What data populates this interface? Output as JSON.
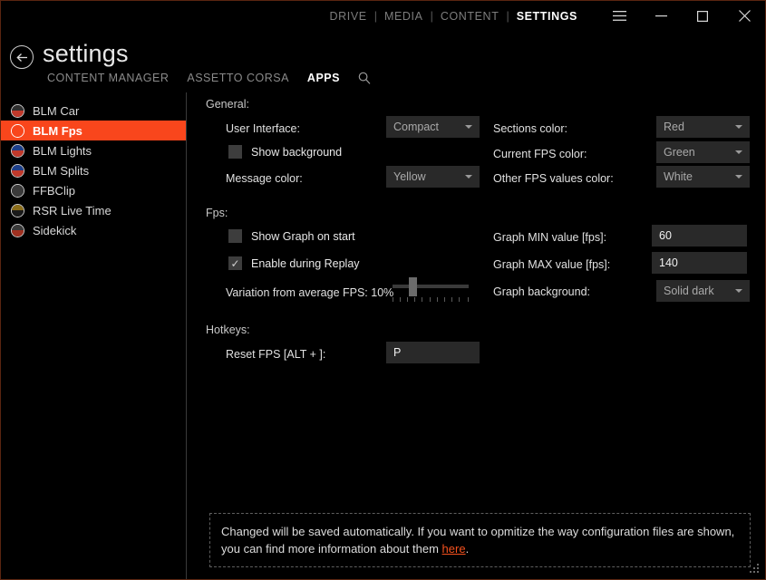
{
  "window": {
    "topnav": [
      {
        "label": "DRIVE",
        "active": false
      },
      {
        "label": "MEDIA",
        "active": false
      },
      {
        "label": "CONTENT",
        "active": false
      },
      {
        "label": "SETTINGS",
        "active": true
      }
    ],
    "separator": "|",
    "controls": {
      "menu": "hamburger-icon",
      "minimize": "minimize-icon",
      "maximize": "maximize-icon",
      "close": "close-icon"
    },
    "border_color": "#5a2510"
  },
  "header": {
    "back": "back-arrow-icon",
    "title": "settings",
    "tabs": [
      {
        "label": "CONTENT MANAGER",
        "active": false
      },
      {
        "label": "ASSETTO CORSA",
        "active": false
      },
      {
        "label": "APPS",
        "active": true
      }
    ],
    "search_icon": "search-icon"
  },
  "sidebar": {
    "selected_color": "#f9461c",
    "items": [
      {
        "label": "BLM Car",
        "selected": false,
        "icon_top": "#2f2f2f",
        "icon_bottom": "#c0392b"
      },
      {
        "label": "BLM Fps",
        "selected": true,
        "icon_top": "#f9461c",
        "icon_bottom": "#f9461c"
      },
      {
        "label": "BLM Lights",
        "selected": false,
        "icon_top": "#1d3f8a",
        "icon_bottom": "#c0392b"
      },
      {
        "label": "BLM Splits",
        "selected": false,
        "icon_top": "#1d3f8a",
        "icon_bottom": "#c0392b"
      },
      {
        "label": "FFBClip",
        "selected": false,
        "icon_top": "#3a3a3a",
        "icon_bottom": "#3a3a3a"
      },
      {
        "label": "RSR Live Time",
        "selected": false,
        "icon_top": "#8a6d1a",
        "icon_bottom": "#1a1a1a"
      },
      {
        "label": "Sidekick",
        "selected": false,
        "icon_top": "#3a3a3a",
        "icon_bottom": "#a03020"
      }
    ]
  },
  "main": {
    "groups": {
      "general": "General:",
      "fps": "Fps:",
      "hotkeys": "Hotkeys:"
    },
    "general": {
      "user_interface": {
        "label": "User Interface:",
        "value": "Compact"
      },
      "show_background": {
        "label": "Show background",
        "checked": false
      },
      "message_color": {
        "label": "Message color:",
        "value": "Yellow"
      },
      "sections_color": {
        "label": "Sections color:",
        "value": "Red"
      },
      "current_fps_color": {
        "label": "Current FPS color:",
        "value": "Green"
      },
      "other_fps_values_color": {
        "label": "Other FPS values color:",
        "value": "White"
      }
    },
    "fps": {
      "show_graph_on_start": {
        "label": "Show Graph on start",
        "checked": false
      },
      "enable_during_replay": {
        "label": "Enable during Replay",
        "checked": true,
        "check_glyph": "✓"
      },
      "variation": {
        "label": "Variation from average FPS: 10%",
        "value": 10,
        "min": 0,
        "max": 100,
        "ticks": 11
      },
      "graph_min": {
        "label": "Graph MIN value [fps]:",
        "value": "60"
      },
      "graph_max": {
        "label": "Graph MAX value [fps]:",
        "value": "140"
      },
      "graph_background": {
        "label": "Graph background:",
        "value": "Solid dark"
      }
    },
    "hotkeys": {
      "reset_fps": {
        "label": "Reset FPS [ALT + ]:",
        "value": "P"
      }
    }
  },
  "notice": {
    "text_before": "Changed will be saved automatically. If you want to opmitize the way configuration files are shown, you can find more information about them ",
    "link": "here",
    "text_after": ".",
    "link_color": "#f4511e"
  }
}
